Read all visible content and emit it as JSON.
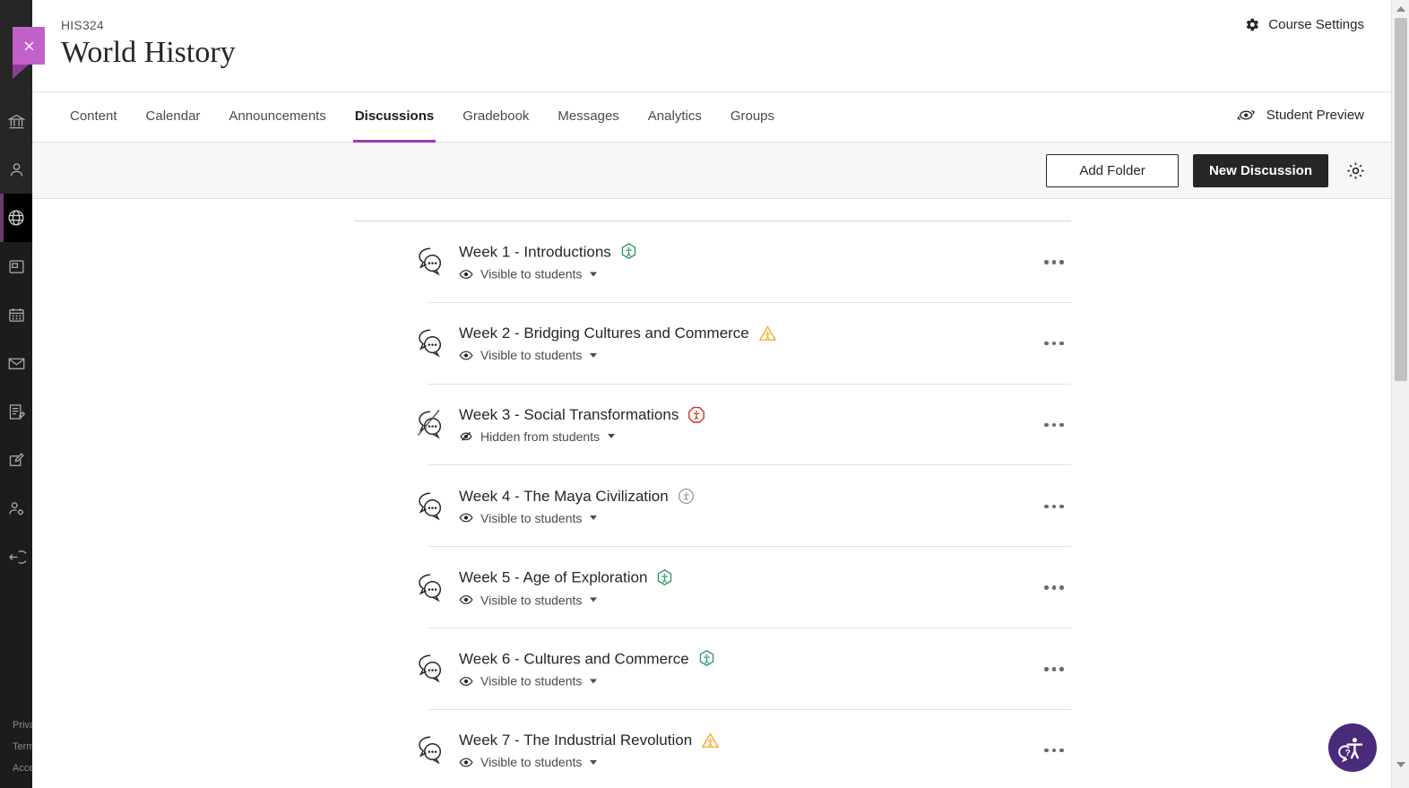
{
  "window": {
    "close_label": "×"
  },
  "rail": {
    "items": [
      {
        "name": "institution-icon",
        "label": "Institution"
      },
      {
        "name": "profile-icon",
        "label": "Profile"
      },
      {
        "name": "courses-globe-icon",
        "label": "Courses"
      },
      {
        "name": "organizations-icon",
        "label": "Organizations"
      },
      {
        "name": "calendar-icon",
        "label": "Calendar"
      },
      {
        "name": "messages-mail-icon",
        "label": "Messages"
      },
      {
        "name": "grades-icon",
        "label": "Grades"
      },
      {
        "name": "tools-edit-icon",
        "label": "Tools"
      },
      {
        "name": "admin-icon",
        "label": "Admin"
      },
      {
        "name": "signout-icon",
        "label": "Sign Out"
      }
    ],
    "footer": [
      "Priva",
      "Term",
      "Acce"
    ]
  },
  "header": {
    "course_code": "HIS324",
    "course_title": "World History",
    "course_settings_label": "Course Settings"
  },
  "tabbar": {
    "tabs": [
      {
        "label": "Content",
        "active": false
      },
      {
        "label": "Calendar",
        "active": false
      },
      {
        "label": "Announcements",
        "active": false
      },
      {
        "label": "Discussions",
        "active": true
      },
      {
        "label": "Gradebook",
        "active": false
      },
      {
        "label": "Messages",
        "active": false
      },
      {
        "label": "Analytics",
        "active": false
      },
      {
        "label": "Groups",
        "active": false
      }
    ],
    "student_preview_label": "Student Preview"
  },
  "toolbar": {
    "add_folder_label": "Add Folder",
    "new_discussion_label": "New Discussion",
    "settings_icon": "gear-icon"
  },
  "discussions": [
    {
      "title": "Week 1 - Introductions",
      "status": "Visible to students",
      "visible": true,
      "badge": "accessibility-hexagon-green"
    },
    {
      "title": "Week 2 - Bridging Cultures and Commerce",
      "status": "Visible to students",
      "visible": true,
      "badge": "accessibility-triangle-orange"
    },
    {
      "title": "Week 3 - Social Transformations",
      "status": "Hidden from students",
      "visible": false,
      "badge": "accessibility-octagon-red"
    },
    {
      "title": "Week 4 - The Maya Civilization",
      "status": "Visible to students",
      "visible": true,
      "badge": "accessibility-circle-gray"
    },
    {
      "title": "Week 5 - Age of Exploration",
      "status": "Visible to students",
      "visible": true,
      "badge": "accessibility-hexagon-green"
    },
    {
      "title": "Week 6 - Cultures and Commerce",
      "status": "Visible to students",
      "visible": true,
      "badge": "accessibility-hexagon-green"
    },
    {
      "title": "Week 7 - The Industrial Revolution",
      "status": "Visible to students",
      "visible": true,
      "badge": "accessibility-triangle-orange"
    }
  ],
  "colors": {
    "accent_purple": "#a334b8",
    "close_ribbon": "#c161c9",
    "rail_dark": "#1c1c1c",
    "badge_green": "#2e9464",
    "badge_orange": "#f5a623",
    "badge_red": "#d93025",
    "badge_gray": "#9a9a9a",
    "a11y_widget": "#4a2a7a",
    "button_dark": "#262626"
  }
}
